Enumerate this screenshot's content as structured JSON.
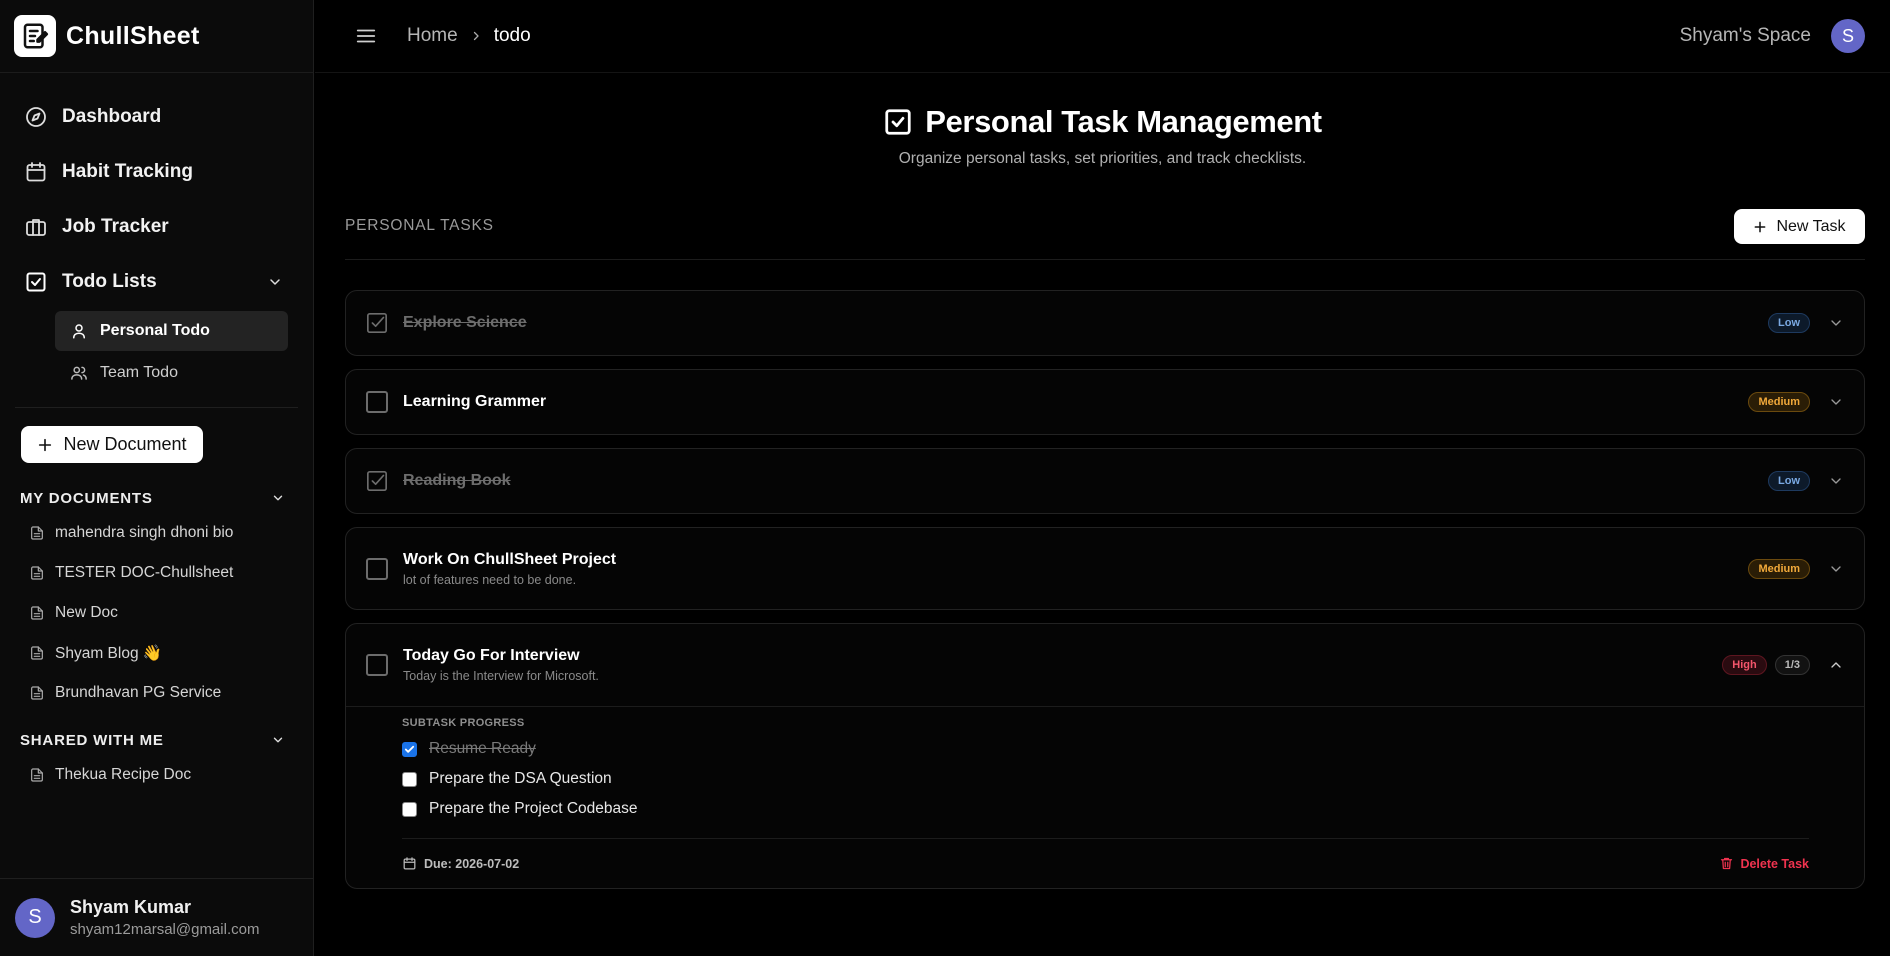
{
  "app": {
    "name": "ChullSheet"
  },
  "sidebar": {
    "nav": [
      {
        "label": "Dashboard",
        "icon": "compass-icon"
      },
      {
        "label": "Habit Tracking",
        "icon": "calendar-icon"
      },
      {
        "label": "Job Tracker",
        "icon": "briefcase-icon"
      },
      {
        "label": "Todo Lists",
        "icon": "checkbox-icon"
      }
    ],
    "todo_sub": [
      {
        "label": "Personal Todo",
        "icon": "user-icon",
        "active": true
      },
      {
        "label": "Team Todo",
        "icon": "users-icon",
        "active": false
      }
    ],
    "new_document_label": "New Document",
    "my_documents_label": "MY DOCUMENTS",
    "my_documents": [
      "mahendra singh dhoni bio",
      "TESTER DOC-Chullsheet",
      "New Doc",
      "Shyam Blog 👋",
      "Brundhavan PG Service"
    ],
    "shared_label": "SHARED WITH ME",
    "shared_documents": [
      "Thekua Recipe Doc"
    ],
    "user": {
      "initial": "S",
      "name": "Shyam Kumar",
      "email": "shyam12marsal@gmail.com"
    }
  },
  "topbar": {
    "breadcrumb_home": "Home",
    "breadcrumb_current": "todo",
    "space_label": "Shyam's Space",
    "avatar_initial": "S"
  },
  "main": {
    "title": "Personal Task Management",
    "subtitle": "Organize personal tasks, set priorities, and track checklists.",
    "section_label": "PERSONAL TASKS",
    "new_task_label": "New Task",
    "tasks": [
      {
        "title": "Explore Science",
        "description": "",
        "done": true,
        "priority": "Low"
      },
      {
        "title": "Learning Grammer",
        "description": "",
        "done": false,
        "priority": "Medium"
      },
      {
        "title": "Reading Book",
        "description": "",
        "done": true,
        "priority": "Low"
      },
      {
        "title": "Work On ChullSheet Project",
        "description": "lot of features need to be done.",
        "done": false,
        "priority": "Medium"
      },
      {
        "title": "Today Go For Interview",
        "description": "Today is the Interview for Microsoft.",
        "done": false,
        "priority": "High",
        "subtask_count": "1/3",
        "expanded": true,
        "subtask_label": "SUBTASK PROGRESS",
        "subtasks": [
          {
            "label": "Resume Ready",
            "done": true
          },
          {
            "label": "Prepare the DSA Question",
            "done": false
          },
          {
            "label": "Prepare the Project Codebase",
            "done": false
          }
        ],
        "due_label": "Due: 2026-07-02",
        "delete_label": "Delete Task"
      }
    ]
  },
  "colors": {
    "background": "#000000",
    "sidebar": "#0b0b0b",
    "accent_avatar": "#6366c7",
    "low": "#7aa9e3",
    "medium": "#f1a93a",
    "high": "#f4566b",
    "danger": "#f0334f",
    "checkbox_checked": "#1a73e8"
  }
}
